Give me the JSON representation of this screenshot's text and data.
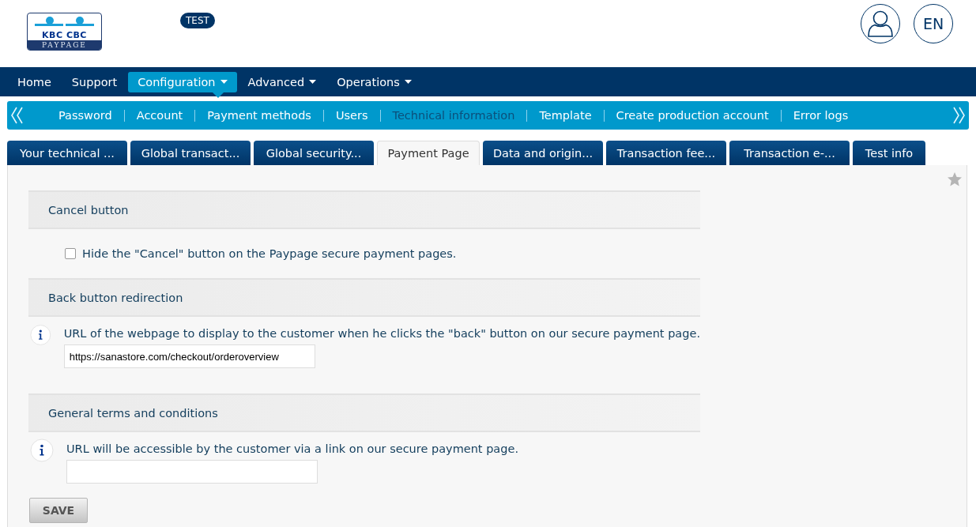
{
  "header": {
    "logo": {
      "brand": "KBC CBC",
      "product": "PAYPAGE"
    },
    "environment_badge": "TEST",
    "language": "EN"
  },
  "main_nav": [
    {
      "label": "Home",
      "selected": false,
      "dropdown": false
    },
    {
      "label": "Support",
      "selected": false,
      "dropdown": false
    },
    {
      "label": "Configuration",
      "selected": true,
      "dropdown": true
    },
    {
      "label": "Advanced",
      "selected": false,
      "dropdown": true
    },
    {
      "label": "Operations",
      "selected": false,
      "dropdown": true
    }
  ],
  "sub_nav": [
    {
      "label": "Password",
      "selected": false
    },
    {
      "label": "Account",
      "selected": false
    },
    {
      "label": "Payment methods",
      "selected": false
    },
    {
      "label": "Users",
      "selected": false
    },
    {
      "label": "Technical information",
      "selected": true
    },
    {
      "label": "Template",
      "selected": false
    },
    {
      "label": "Create production account",
      "selected": false
    },
    {
      "label": "Error logs",
      "selected": false
    }
  ],
  "tabs": [
    {
      "label": "Your technical ...",
      "selected": false
    },
    {
      "label": "Global transact...",
      "selected": false
    },
    {
      "label": "Global security...",
      "selected": false
    },
    {
      "label": "Payment Page",
      "selected": true
    },
    {
      "label": "Data and origin...",
      "selected": false
    },
    {
      "label": "Transaction fee...",
      "selected": false
    },
    {
      "label": "Transaction e-...",
      "selected": false
    },
    {
      "label": "Test info",
      "selected": false
    }
  ],
  "sections": [
    {
      "title": "Cancel button",
      "kind": "checkbox",
      "label": "Hide the \"Cancel\" button on the Paypage secure payment pages.",
      "checked": false
    },
    {
      "title": "Back button redirection",
      "kind": "url",
      "help": "URL of the webpage to display to the customer when he clicks the \"back\" button on our secure payment page.",
      "value": "https://sanastore.com/checkout/orderoverview"
    },
    {
      "title": "General terms and conditions",
      "kind": "url",
      "help": "URL will be accessible by the customer via a link on our secure payment page."
    }
  ],
  "save_button": "SAVE"
}
